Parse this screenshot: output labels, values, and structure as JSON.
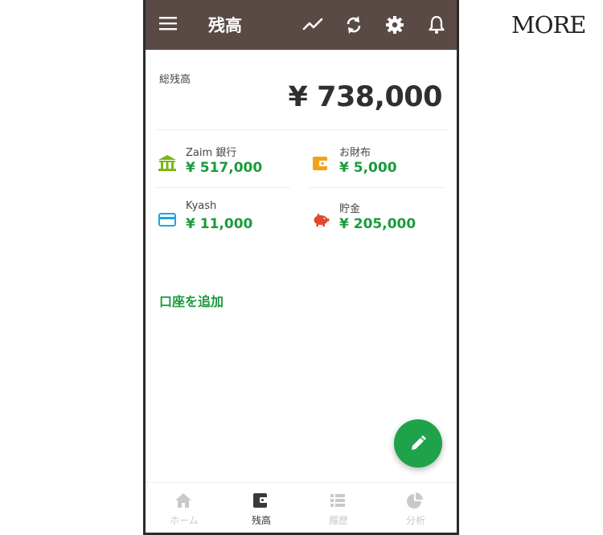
{
  "brand": "MORE",
  "appbar": {
    "title": "残高",
    "menu_icon": "menu-icon",
    "actions": [
      "trend-icon",
      "sync-icon",
      "gear-icon",
      "bell-icon"
    ]
  },
  "summary": {
    "label": "総残高",
    "total": "¥ 738,000"
  },
  "accounts": [
    {
      "name": "Zaim 銀行",
      "amount": "¥ 517,000",
      "icon": "bank-icon",
      "color": "#7cb518"
    },
    {
      "name": "お財布",
      "amount": "¥ 5,000",
      "icon": "wallet-icon",
      "color": "#f0a31a"
    },
    {
      "name": "Kyash",
      "amount": "¥ 11,000",
      "icon": "card-icon",
      "color": "#1ba6e0"
    },
    {
      "name": "貯金",
      "amount": "¥ 205,000",
      "icon": "piggy-bank-icon",
      "color": "#e04a2a"
    }
  ],
  "add_account_label": "口座を追加",
  "fab": {
    "icon": "pencil-icon"
  },
  "colors": {
    "appbar": "#5a4a45",
    "accent": "#1a9b3c",
    "fab": "#1fa34a"
  },
  "bottom_nav": [
    {
      "label": "ホーム",
      "icon": "home-icon",
      "active": false
    },
    {
      "label": "残高",
      "icon": "wallet-icon",
      "active": true
    },
    {
      "label": "履歴",
      "icon": "list-icon",
      "active": false
    },
    {
      "label": "分析",
      "icon": "pie-chart-icon",
      "active": false
    }
  ]
}
